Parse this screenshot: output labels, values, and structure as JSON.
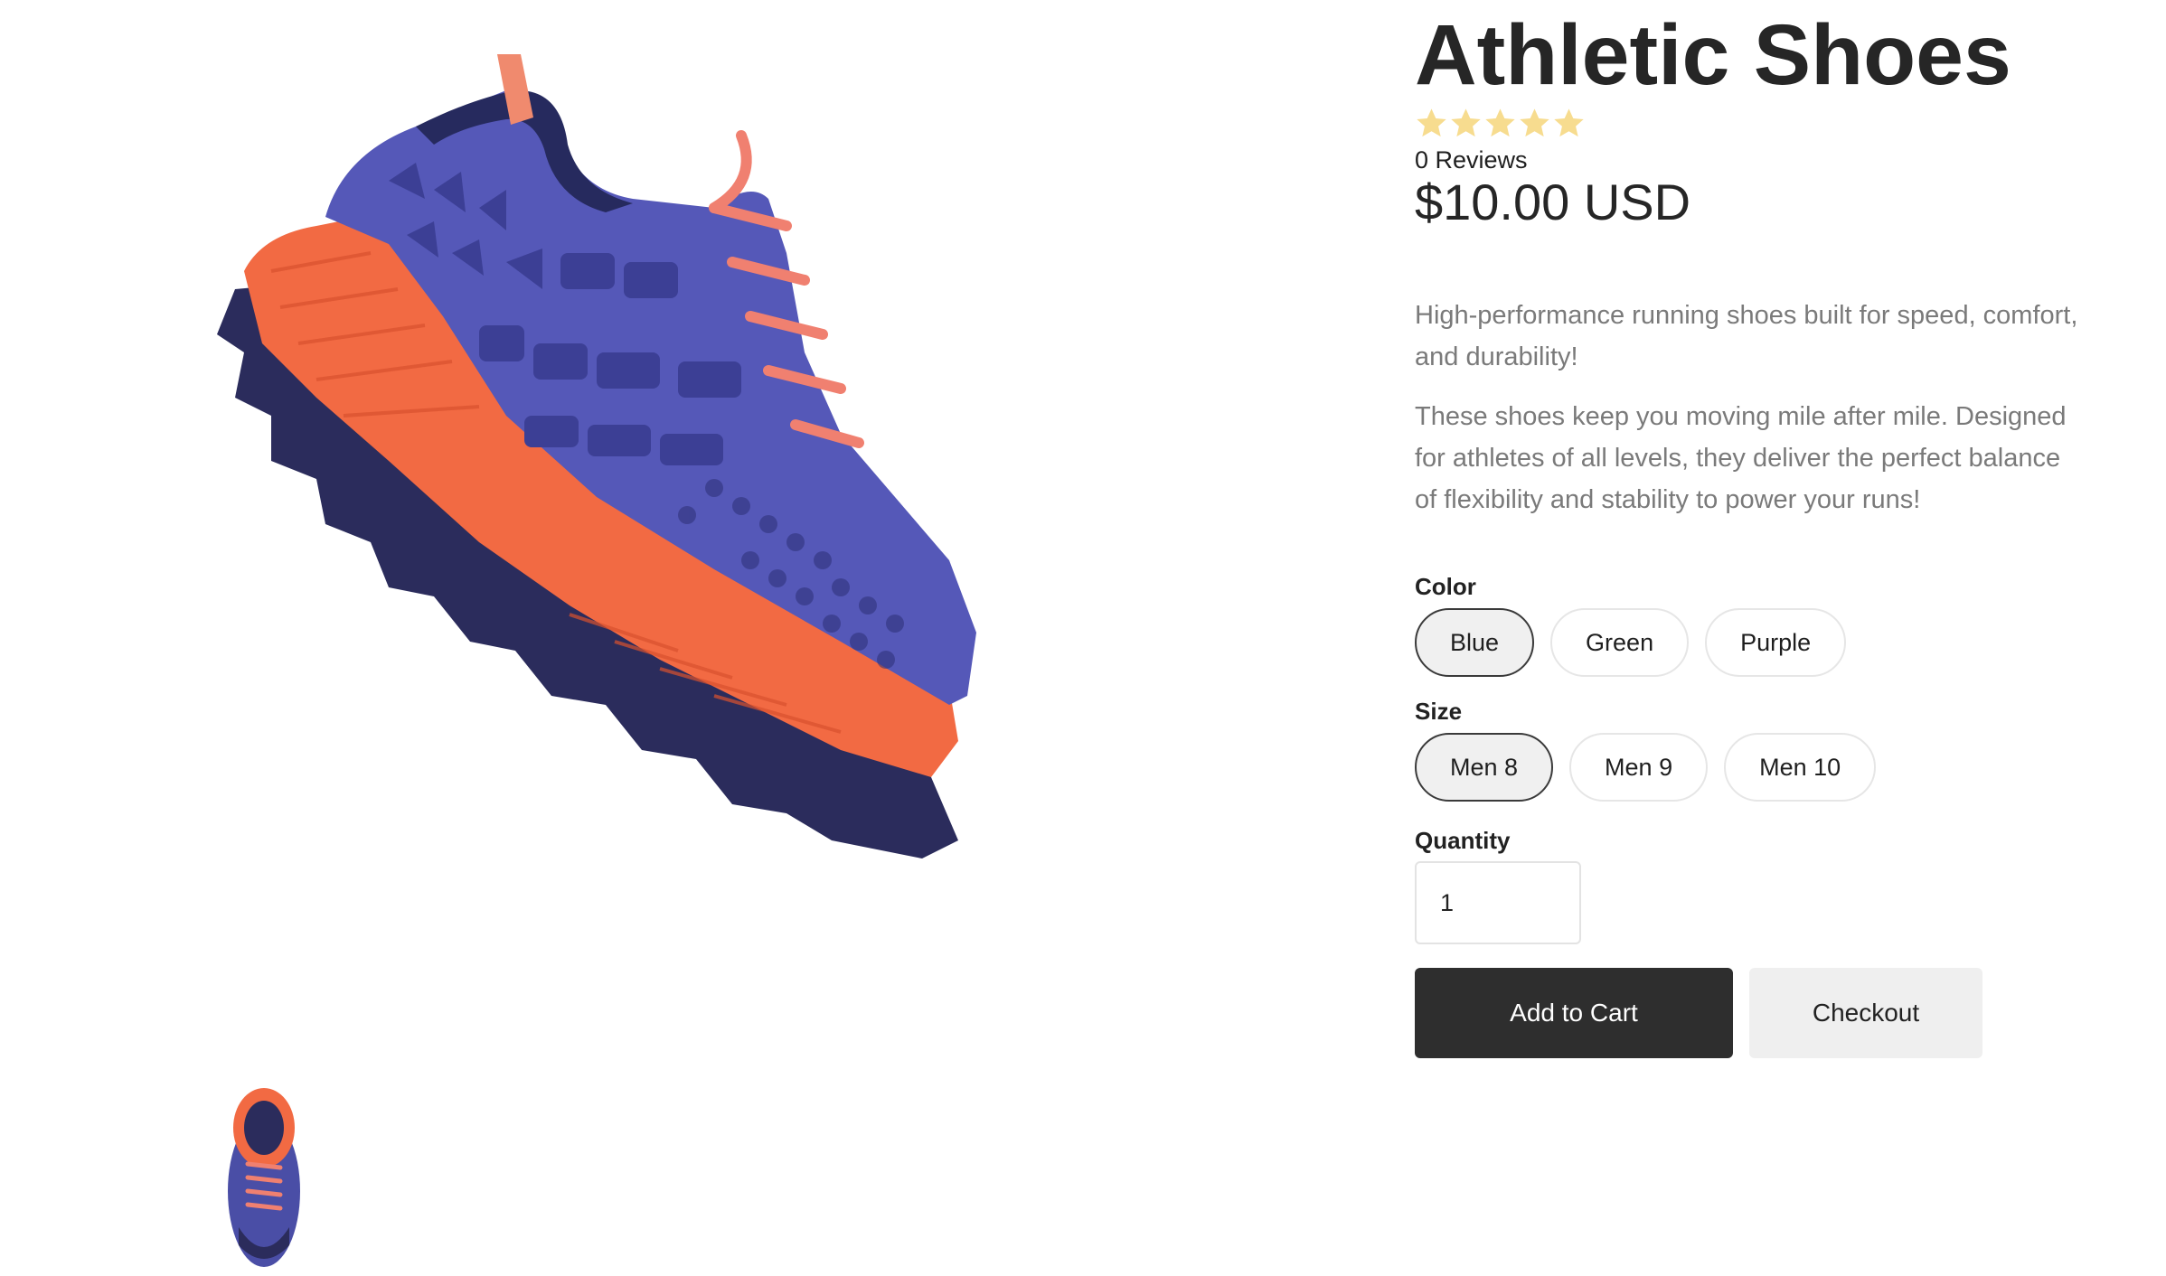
{
  "product": {
    "title": "Athletic Shoes",
    "rating": 0,
    "rating_max": 5,
    "reviews_label": "0 Reviews",
    "price": "$10.00 USD",
    "description": [
      "High-performance running shoes built for speed, comfort, and durability!",
      "These shoes keep you moving mile after mile. Designed for athletes of all levels, they deliver the perfect balance of flexibility and stability to power your runs!"
    ]
  },
  "options": {
    "color": {
      "label": "Color",
      "selected": "Blue",
      "values": [
        "Blue",
        "Green",
        "Purple"
      ]
    },
    "size": {
      "label": "Size",
      "selected": "Men 8",
      "values": [
        "Men 8",
        "Men 9",
        "Men 10"
      ]
    },
    "quantity": {
      "label": "Quantity",
      "value": "1"
    }
  },
  "actions": {
    "add_to_cart": "Add to Cart",
    "checkout": "Checkout"
  },
  "media": {
    "main_image": "running-shoe-side-view",
    "thumbnails": [
      "running-shoe-top-view"
    ]
  },
  "colors": {
    "star": "#f7dc8f",
    "shoe_upper": "#5558b8",
    "shoe_midsole": "#f26a43",
    "primary_button": "#2e2e2e",
    "secondary_button": "#efefef"
  }
}
